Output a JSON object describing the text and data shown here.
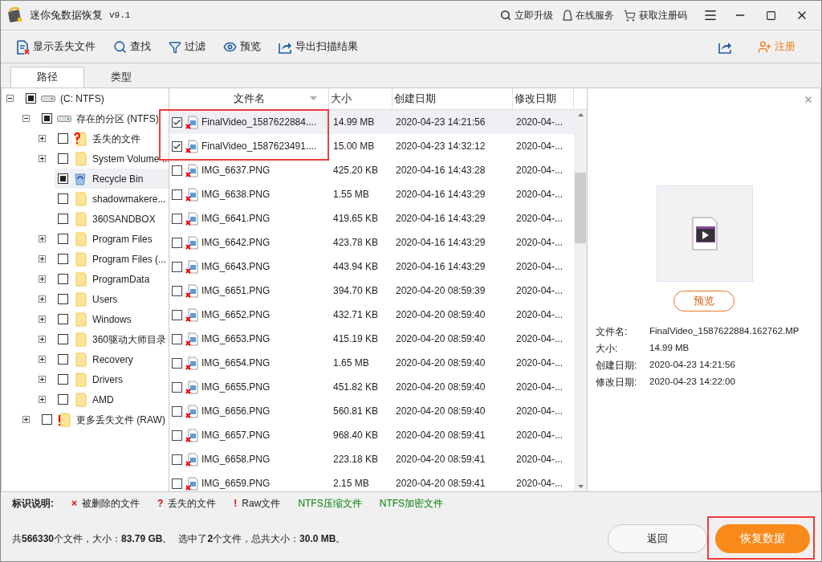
{
  "window": {
    "title": "迷你兔数据恢复",
    "version": "v9.1",
    "links": [
      {
        "kind": "upgrade",
        "label": "立即升级"
      },
      {
        "kind": "service",
        "label": "在线服务"
      },
      {
        "kind": "cart",
        "label": "获取注册码"
      }
    ]
  },
  "toolbar": {
    "items": [
      {
        "kind": "lost",
        "label": "显示丢失文件"
      },
      {
        "kind": "find",
        "label": "查找"
      },
      {
        "kind": "filter",
        "label": "过滤"
      },
      {
        "kind": "preview",
        "label": "预览"
      },
      {
        "kind": "export",
        "label": "导出扫描结果"
      }
    ],
    "register": "注册"
  },
  "tabs": [
    {
      "label": "路径",
      "selected": true
    },
    {
      "label": "类型",
      "selected": false
    }
  ],
  "tree": [
    {
      "name": "(C: NTFS)",
      "kind": "drive",
      "partial": true,
      "expanded": true,
      "selected": false,
      "children": [
        {
          "name": "存在的分区 (NTFS)",
          "kind": "drive",
          "partial": true,
          "expanded": true,
          "selected": false,
          "children": [
            {
              "name": "丢失的文件",
              "kind": "lost",
              "partial": false,
              "expanded": false,
              "selected": false
            },
            {
              "name": "System Volume ...",
              "kind": "folder",
              "partial": false,
              "expanded": false,
              "selected": false
            },
            {
              "name": "Recycle Bin",
              "kind": "recycle",
              "partial": true,
              "selected": true
            },
            {
              "name": "shadowmakere...",
              "kind": "folder",
              "partial": false,
              "selected": false
            },
            {
              "name": "360SANDBOX",
              "kind": "folder",
              "partial": false,
              "selected": false
            },
            {
              "name": "Program Files",
              "kind": "folder",
              "partial": false,
              "expanded": false,
              "selected": false
            },
            {
              "name": "Program Files (...",
              "kind": "folder",
              "partial": false,
              "expanded": false,
              "selected": false
            },
            {
              "name": "ProgramData",
              "kind": "folder",
              "partial": false,
              "expanded": false,
              "selected": false
            },
            {
              "name": "Users",
              "kind": "folder",
              "partial": false,
              "expanded": false,
              "selected": false
            },
            {
              "name": "Windows",
              "kind": "folder",
              "partial": false,
              "expanded": false,
              "selected": false
            },
            {
              "name": "360驱动大师目录",
              "kind": "folder",
              "partial": false,
              "expanded": false,
              "selected": false
            },
            {
              "name": "Recovery",
              "kind": "folder",
              "partial": false,
              "expanded": false,
              "selected": false
            },
            {
              "name": "Drivers",
              "kind": "folder",
              "partial": false,
              "expanded": false,
              "selected": false
            },
            {
              "name": "AMD",
              "kind": "folder",
              "partial": false,
              "expanded": false,
              "selected": false
            }
          ]
        },
        {
          "name": "更多丢失文件 (RAW)",
          "kind": "raw",
          "partial": false,
          "expanded": false,
          "selected": false
        }
      ]
    }
  ],
  "table": {
    "columns": [
      "文件名",
      "大小",
      "创建日期",
      "修改日期"
    ],
    "rows": [
      {
        "checked": true,
        "selected": true,
        "name": "FinalVideo_1587622884....",
        "size": "14.99 MB",
        "created": "2020-04-23 14:21:56",
        "modified": "2020-04-..."
      },
      {
        "checked": true,
        "selected": false,
        "name": "FinalVideo_1587623491....",
        "size": "15.00 MB",
        "created": "2020-04-23 14:32:12",
        "modified": "2020-04-..."
      },
      {
        "checked": false,
        "selected": false,
        "name": "IMG_6637.PNG",
        "size": "425.20 KB",
        "created": "2020-04-16 14:43:28",
        "modified": "2020-04-..."
      },
      {
        "checked": false,
        "selected": false,
        "name": "IMG_6638.PNG",
        "size": "1.55 MB",
        "created": "2020-04-16 14:43:29",
        "modified": "2020-04-..."
      },
      {
        "checked": false,
        "selected": false,
        "name": "IMG_6641.PNG",
        "size": "419.65 KB",
        "created": "2020-04-16 14:43:29",
        "modified": "2020-04-..."
      },
      {
        "checked": false,
        "selected": false,
        "name": "IMG_6642.PNG",
        "size": "423.78 KB",
        "created": "2020-04-16 14:43:29",
        "modified": "2020-04-..."
      },
      {
        "checked": false,
        "selected": false,
        "name": "IMG_6643.PNG",
        "size": "443.94 KB",
        "created": "2020-04-16 14:43:29",
        "modified": "2020-04-..."
      },
      {
        "checked": false,
        "selected": false,
        "name": "IMG_6651.PNG",
        "size": "394.70 KB",
        "created": "2020-04-20 08:59:39",
        "modified": "2020-04-..."
      },
      {
        "checked": false,
        "selected": false,
        "name": "IMG_6652.PNG",
        "size": "432.71 KB",
        "created": "2020-04-20 08:59:40",
        "modified": "2020-04-..."
      },
      {
        "checked": false,
        "selected": false,
        "name": "IMG_6653.PNG",
        "size": "415.19 KB",
        "created": "2020-04-20 08:59:40",
        "modified": "2020-04-..."
      },
      {
        "checked": false,
        "selected": false,
        "name": "IMG_6654.PNG",
        "size": "1.65 MB",
        "created": "2020-04-20 08:59:40",
        "modified": "2020-04-..."
      },
      {
        "checked": false,
        "selected": false,
        "name": "IMG_6655.PNG",
        "size": "451.82 KB",
        "created": "2020-04-20 08:59:40",
        "modified": "2020-04-..."
      },
      {
        "checked": false,
        "selected": false,
        "name": "IMG_6656.PNG",
        "size": "560.81 KB",
        "created": "2020-04-20 08:59:40",
        "modified": "2020-04-..."
      },
      {
        "checked": false,
        "selected": false,
        "name": "IMG_6657.PNG",
        "size": "968.40 KB",
        "created": "2020-04-20 08:59:41",
        "modified": "2020-04-..."
      },
      {
        "checked": false,
        "selected": false,
        "name": "IMG_6658.PNG",
        "size": "223.18 KB",
        "created": "2020-04-20 08:59:41",
        "modified": "2020-04-..."
      },
      {
        "checked": false,
        "selected": false,
        "name": "IMG_6659.PNG",
        "size": "2.15 MB",
        "created": "2020-04-20 08:59:41",
        "modified": "2020-04-..."
      }
    ]
  },
  "preview": {
    "button": "预览",
    "details": [
      {
        "label": "文件名:",
        "value": "FinalVideo_1587622884.162762.MP"
      },
      {
        "label": "大小:",
        "value": "14.99 MB"
      },
      {
        "label": "创建日期:",
        "value": "2020-04-23 14:21:56"
      },
      {
        "label": "修改日期:",
        "value": "2020-04-23 14:22:00"
      }
    ]
  },
  "legend": {
    "title": "标识说明:",
    "items": [
      {
        "kind": "marker",
        "marker": "×",
        "text": "被删除的文件",
        "color": "#e00000"
      },
      {
        "kind": "marker",
        "marker": "?",
        "text": "丢失的文件",
        "color": "#e00000"
      },
      {
        "kind": "marker",
        "marker": "!",
        "text": "Raw文件",
        "color": "#e00000"
      },
      {
        "kind": "colored",
        "text": "NTFS压缩文件",
        "color": "#008000"
      },
      {
        "kind": "colored",
        "text": "NTFS加密文件",
        "color": "#008000"
      }
    ]
  },
  "status": {
    "total": "共**566330**个文件，大小：**83.79 GB**。",
    "selection": "选中了**2**个文件，总共大小：**30.0 MB**。"
  },
  "buttons": {
    "back": "返回",
    "recover": "恢复数据"
  }
}
